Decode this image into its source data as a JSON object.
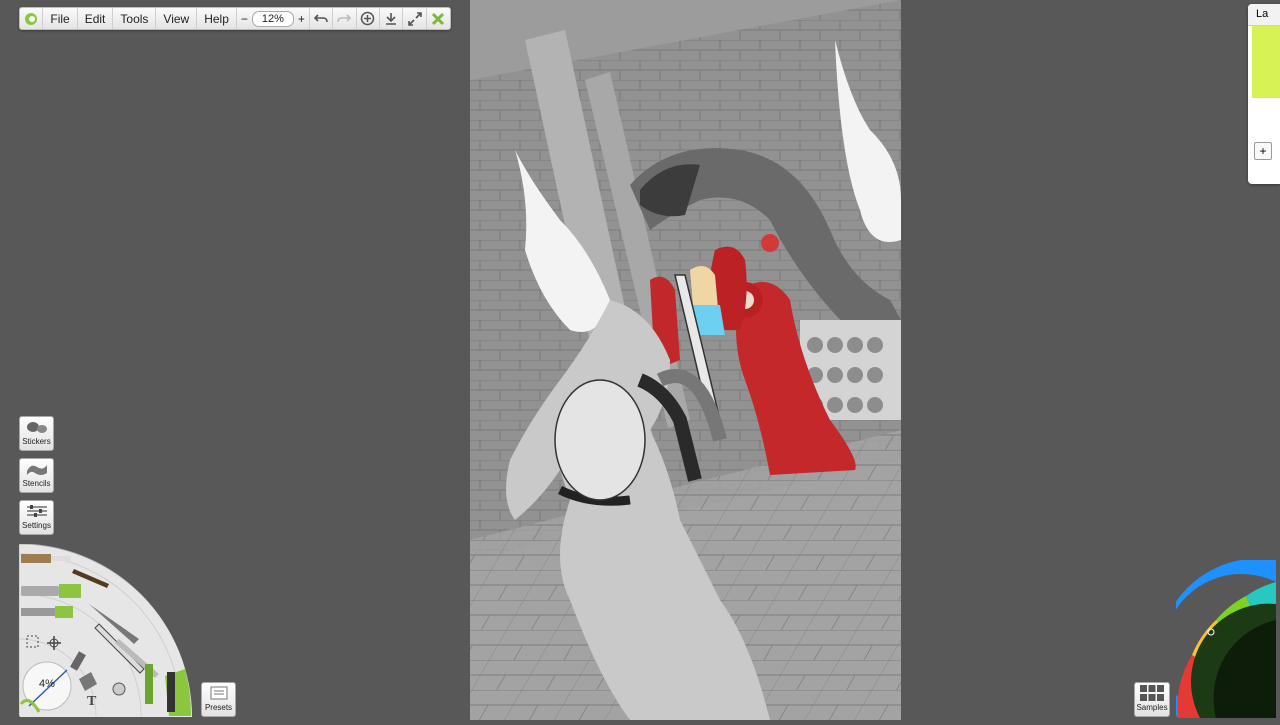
{
  "toolbar": {
    "menus": [
      "File",
      "Edit",
      "Tools",
      "View",
      "Help"
    ],
    "zoom": "12%",
    "zoom_out": "−",
    "zoom_in": "+"
  },
  "left_panel": {
    "stickers_label": "Stickers",
    "stencils_label": "Stencils",
    "settings_label": "Settings"
  },
  "tool_wheel": {
    "brush_size": "4%",
    "text_tool": "T",
    "tools": [
      "oil-brush",
      "watercolor-brush",
      "paint-tube",
      "palette-knife",
      "airbrush",
      "pencil",
      "chalk",
      "felt-pen",
      "selection",
      "transform",
      "eraser",
      "fill",
      "glitter",
      "gloop-pen",
      "text"
    ]
  },
  "presets_label": "Presets",
  "samples_label": "Samples",
  "layers_panel": {
    "tab_label": "La",
    "add_label": "+",
    "thumbnail_color": "#d6f255"
  },
  "colors": {
    "background": "#585858",
    "accent_green": "#8cc63f",
    "canvas_gray": "#9a9a9a"
  }
}
